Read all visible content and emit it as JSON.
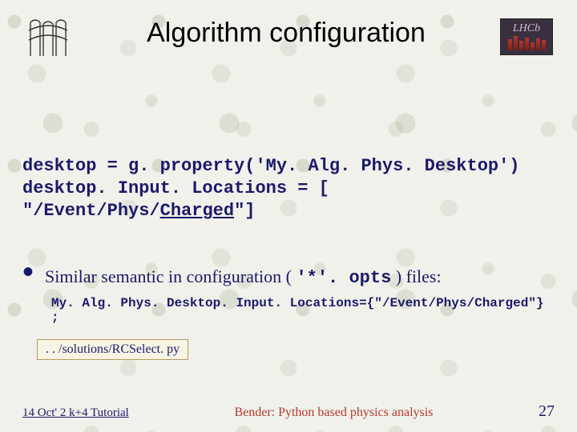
{
  "header": {
    "title": "Algorithm configuration",
    "logo_right_text": "LHCb"
  },
  "code": {
    "line1": "desktop = g. property('My. Alg. Phys. Desktop')",
    "line2": "desktop. Input. Locations = [",
    "line3_prefix": "  \"/Event/Phys/",
    "line3_underlined": "Charged",
    "line3_suffix": "\"]"
  },
  "bullet": {
    "text_before": "Similar semantic in configuration ( ",
    "mono": "'*'. opts",
    "text_after": " ) files:"
  },
  "opts_line": "My. Alg. Phys. Desktop. Input. Locations={\"/Event/Phys/Charged\"} ;",
  "path_box": ". . /solutions/RCSelect. py",
  "footer": {
    "left": "14 Oct' 2 k+4 Tutorial",
    "center": "Bender: Python based physics analysis",
    "page": "27"
  }
}
